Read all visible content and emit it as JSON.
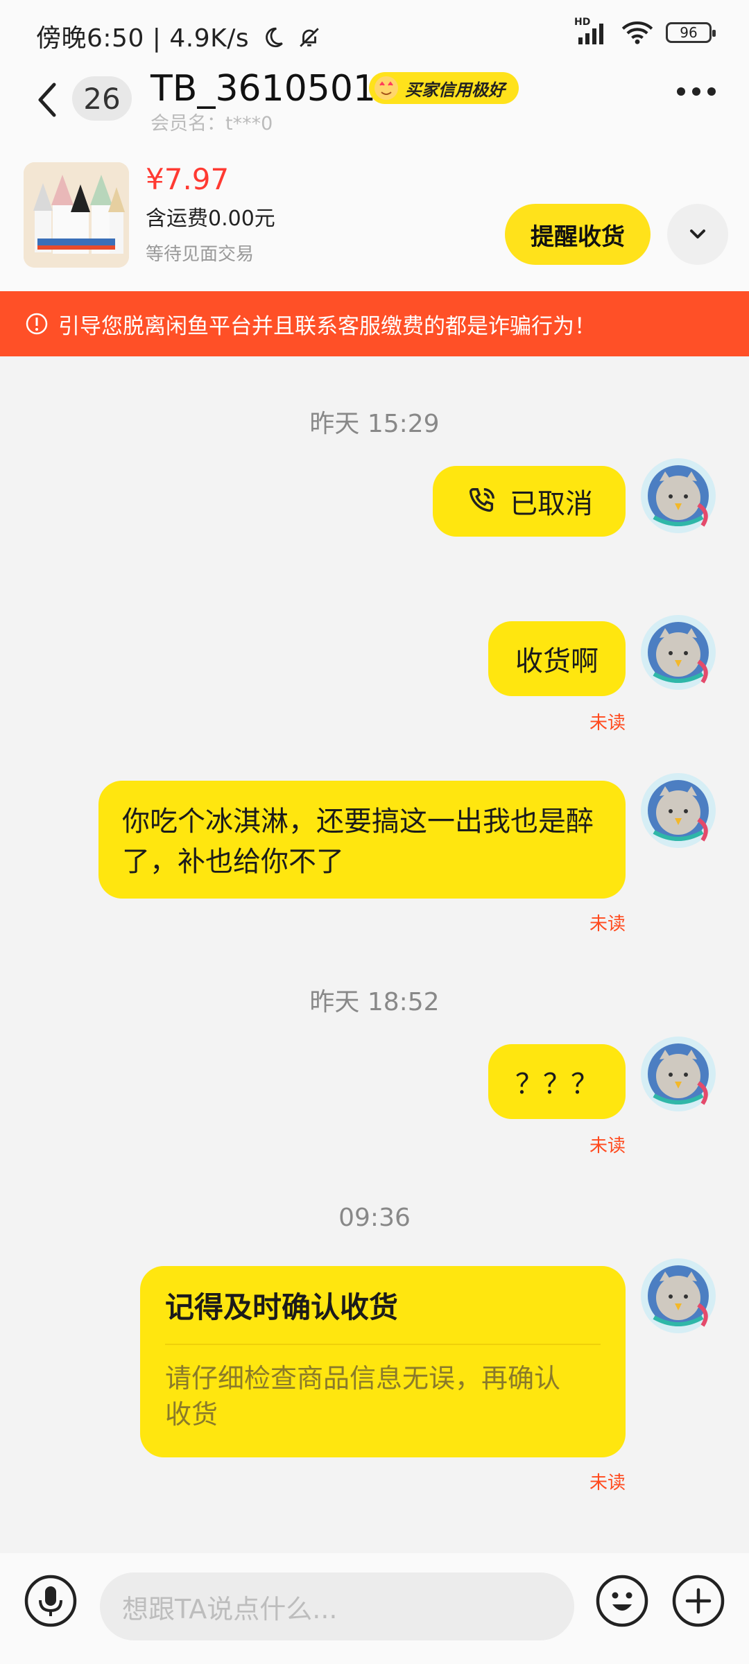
{
  "status_bar": {
    "time": "傍晚6:50 | 4.9K/s",
    "network": "HD",
    "battery": "96"
  },
  "header": {
    "unread_count": "26",
    "name": "TB_36105018",
    "badge": "买家信用极好",
    "member": "会员名：t***0"
  },
  "product": {
    "price": "¥7.97",
    "shipping": "含运费0.00元",
    "status": "等待见面交易",
    "remind_button": "提醒收货"
  },
  "warning": "引导您脱离闲鱼平台并且联系客服缴费的都是诈骗行为！",
  "chat": {
    "time1": "昨天 15:29",
    "call_cancelled": "已取消",
    "msg_receive": "收货啊",
    "msg_long": "你吃个冰淇淋，还要搞这一出我也是醉了，补也给你不了",
    "time2": "昨天 18:52",
    "msg_question": "？？？",
    "time3": "09:36",
    "card_title": "记得及时确认收货",
    "card_body": "请仔细检查商品信息无误，再确认收货",
    "unread_label": "未读"
  },
  "input": {
    "placeholder": "想跟TA说点什么..."
  },
  "colors": {
    "accent_yellow": "#ffe60f",
    "warning_red": "#ff5027",
    "price_red": "#ff3a32",
    "unread_red": "#ff4a1e"
  }
}
